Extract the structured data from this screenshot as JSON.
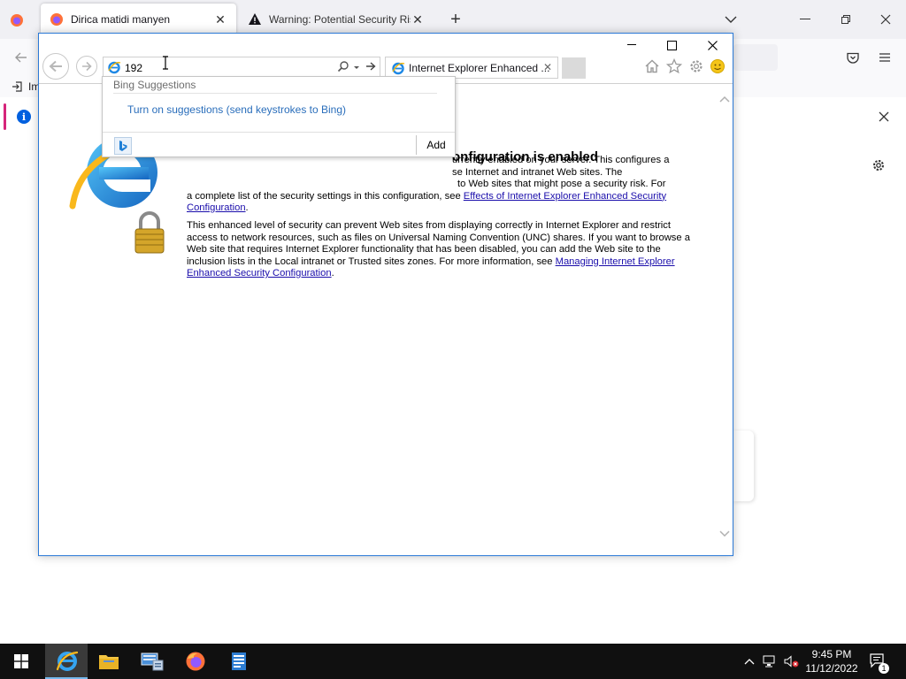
{
  "firefox": {
    "tabs": [
      {
        "title": "Dirica matidi manyen",
        "active": true
      },
      {
        "title": "Warning: Potential Security Risk",
        "active": false
      }
    ],
    "bookmark_label": "Im",
    "colors": {
      "tab_bar": "#f0f0f4",
      "toolbar": "#f9f9fb",
      "info_blue": "#0060df"
    }
  },
  "ie": {
    "address_value": "192",
    "tab_title": "Internet Explorer Enhanced ...",
    "page": {
      "title": "onfiguration is enabled",
      "para1_lines": [
        "urrently enabled on your server. This configures a",
        "se Internet and intranet Web sites. The",
        "to Web sites that might pose a security risk. For"
      ],
      "para1_tail": "a complete list of the security settings in this configuration, see ",
      "para1_link": "Effects of Internet Explorer Enhanced Security Configuration",
      "para1_end": ".",
      "para2": "This enhanced level of security can prevent Web sites from displaying correctly in Internet Explorer and restrict access to network resources, such as files on Universal Naming Convention (UNC) shares. If you want to browse a Web site that requires Internet Explorer functionality that has been disabled, you can add the Web site to the inclusion lists in the Local intranet or Trusted sites zones. For more information, see ",
      "para2_link": "Managing Internet Explorer Enhanced Security Configuration",
      "para2_end": "."
    },
    "suggestions": {
      "heading": "Bing Suggestions",
      "link": "Turn on suggestions (send keystrokes to Bing)",
      "add_label": "Add"
    },
    "colors": {
      "window_border": "#2b79d6",
      "link": "#1a0dab",
      "suggestion_link": "#2a6ebb"
    }
  },
  "taskbar": {
    "items": [
      "start-button",
      "internet-explorer",
      "file-explorer",
      "server-manager",
      "firefox",
      "notepad-app"
    ],
    "time": "9:45 PM",
    "date": "11/12/2022",
    "notification_count": "1"
  }
}
